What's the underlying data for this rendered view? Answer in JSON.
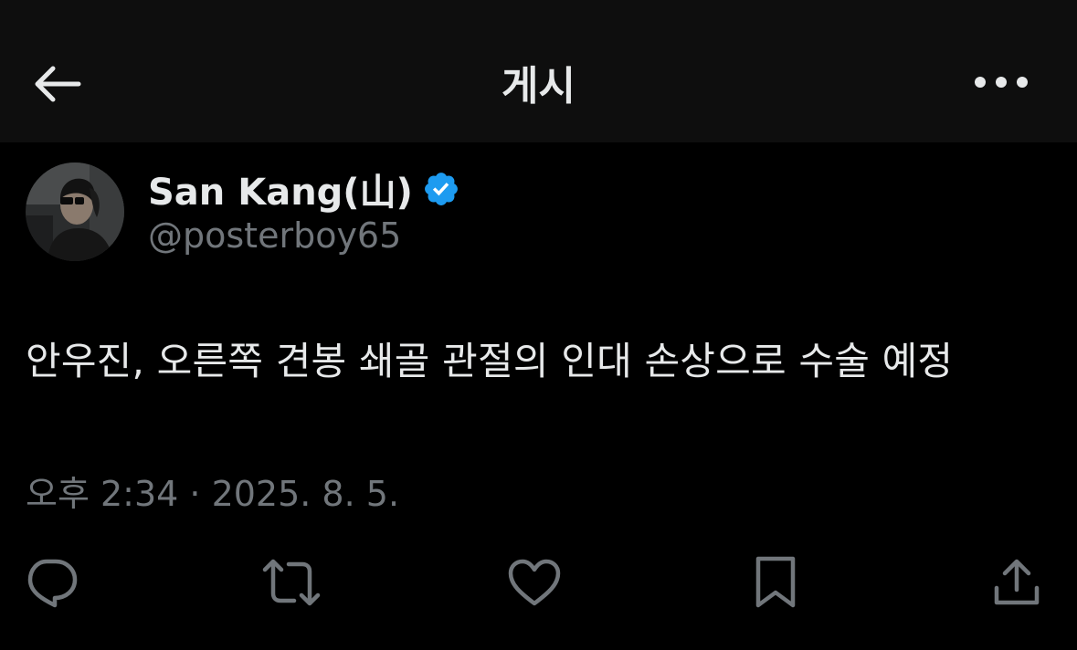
{
  "header": {
    "title": "게시",
    "back_icon": "arrow-left-icon",
    "more_icon": "more-horizontal-icon"
  },
  "author": {
    "display_name": "San Kang(山)",
    "handle": "@posterboy65",
    "verified": true,
    "verified_color": "#1d9bf0"
  },
  "post": {
    "text": "안우진, 오른쪽 견봉 쇄골 관절의 인대 손상으로 수술 예정",
    "timestamp": "오후 2:34 · 2025. 8. 5."
  },
  "actions": [
    {
      "icon": "reply-icon"
    },
    {
      "icon": "repost-icon"
    },
    {
      "icon": "like-icon"
    },
    {
      "icon": "bookmark-icon"
    },
    {
      "icon": "share-icon"
    }
  ],
  "colors": {
    "background": "#000000",
    "header_background": "#0e0e0e",
    "text_primary": "#e7e9ea",
    "text_secondary": "#71767b"
  }
}
